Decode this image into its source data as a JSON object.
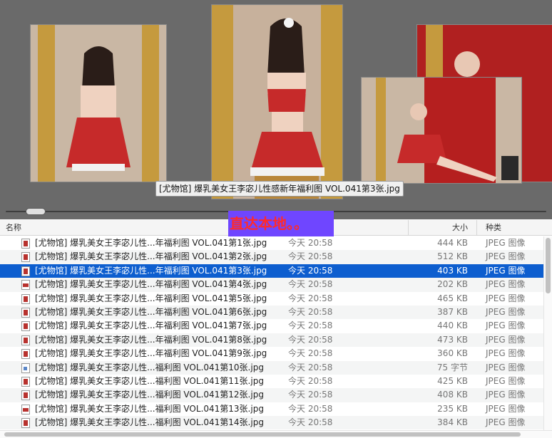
{
  "coverflow": {
    "caption": "[尤物馆] 爆乳美女王李宓儿性感新年福利图 VOL.041第3张.jpg",
    "position": 0.04
  },
  "banner_text": "直达本地。。",
  "columns": {
    "name": "名称",
    "size": "大小",
    "kind": "种类"
  },
  "selected_index": 2,
  "files": [
    {
      "name": "[尤物馆] 爆乳美女王李宓儿性...年福利图 VOL.041第1张.jpg",
      "date": "今天 20:58",
      "size": "444 KB",
      "kind": "JPEG 图像",
      "icon": "photo-portrait-icon"
    },
    {
      "name": "[尤物馆] 爆乳美女王李宓儿性...年福利图 VOL.041第2张.jpg",
      "date": "今天 20:58",
      "size": "512 KB",
      "kind": "JPEG 图像",
      "icon": "photo-portrait-icon"
    },
    {
      "name": "[尤物馆] 爆乳美女王李宓儿性...年福利图 VOL.041第3张.jpg",
      "date": "今天 20:58",
      "size": "403 KB",
      "kind": "JPEG 图像",
      "icon": "photo-portrait-icon"
    },
    {
      "name": "[尤物馆] 爆乳美女王李宓儿性...年福利图 VOL.041第4张.jpg",
      "date": "今天 20:58",
      "size": "202 KB",
      "kind": "JPEG 图像",
      "icon": "photo-landscape-icon"
    },
    {
      "name": "[尤物馆] 爆乳美女王李宓儿性...年福利图 VOL.041第5张.jpg",
      "date": "今天 20:58",
      "size": "465 KB",
      "kind": "JPEG 图像",
      "icon": "photo-portrait-icon"
    },
    {
      "name": "[尤物馆] 爆乳美女王李宓儿性...年福利图 VOL.041第6张.jpg",
      "date": "今天 20:58",
      "size": "387 KB",
      "kind": "JPEG 图像",
      "icon": "photo-portrait-icon"
    },
    {
      "name": "[尤物馆] 爆乳美女王李宓儿性...年福利图 VOL.041第7张.jpg",
      "date": "今天 20:58",
      "size": "440 KB",
      "kind": "JPEG 图像",
      "icon": "photo-portrait-icon"
    },
    {
      "name": "[尤物馆] 爆乳美女王李宓儿性...年福利图 VOL.041第8张.jpg",
      "date": "今天 20:58",
      "size": "473 KB",
      "kind": "JPEG 图像",
      "icon": "photo-portrait-icon"
    },
    {
      "name": "[尤物馆] 爆乳美女王李宓儿性...年福利图 VOL.041第9张.jpg",
      "date": "今天 20:58",
      "size": "360 KB",
      "kind": "JPEG 图像",
      "icon": "photo-portrait-icon"
    },
    {
      "name": "[尤物馆] 爆乳美女王李宓儿性...福利图 VOL.041第10张.jpg",
      "date": "今天 20:58",
      "size": "75 字节",
      "kind": "JPEG 图像",
      "icon": "document-icon"
    },
    {
      "name": "[尤物馆] 爆乳美女王李宓儿性...福利图 VOL.041第11张.jpg",
      "date": "今天 20:58",
      "size": "425 KB",
      "kind": "JPEG 图像",
      "icon": "photo-portrait-icon"
    },
    {
      "name": "[尤物馆] 爆乳美女王李宓儿性...福利图 VOL.041第12张.jpg",
      "date": "今天 20:58",
      "size": "408 KB",
      "kind": "JPEG 图像",
      "icon": "photo-portrait-icon"
    },
    {
      "name": "[尤物馆] 爆乳美女王李宓儿性...福利图 VOL.041第13张.jpg",
      "date": "今天 20:58",
      "size": "235 KB",
      "kind": "JPEG 图像",
      "icon": "photo-landscape-icon"
    },
    {
      "name": "[尤物馆] 爆乳美女王李宓儿性...福利图 VOL.041第14张.jpg",
      "date": "今天 20:58",
      "size": "384 KB",
      "kind": "JPEG 图像",
      "icon": "photo-portrait-icon"
    }
  ],
  "colors": {
    "selection": "#0d5ecf",
    "coverflow_bg": "#6a6a6a",
    "banner_bg": "#6f46ff",
    "banner_text": "#ff2a2a"
  }
}
